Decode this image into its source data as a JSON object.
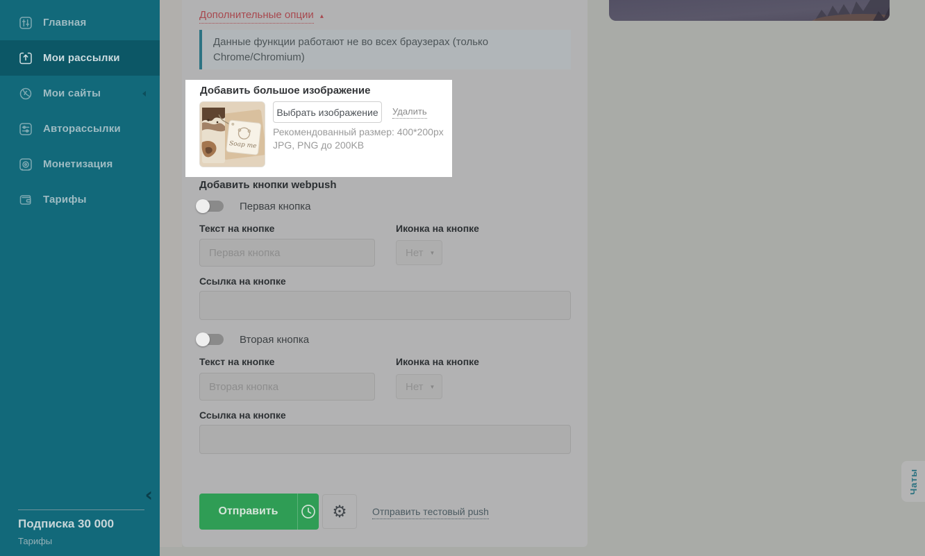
{
  "colors": {
    "sidebar_bg": "#12697a",
    "sidebar_active_bg": "#0c5766",
    "accent_teal": "#2c7383",
    "link_red": "#a8494f",
    "button_green": "#2f9d55",
    "spotlight_bg": "#ffffff"
  },
  "sidebar": {
    "items": [
      {
        "icon": "sliders-icon",
        "label": "Главная",
        "active": false
      },
      {
        "icon": "upload-icon",
        "label": "Мои рассылки",
        "active": true
      },
      {
        "icon": "globe-icon",
        "label": "Мои сайты",
        "active": false,
        "has_submenu": true
      },
      {
        "icon": "automation-icon",
        "label": "Авторассылки",
        "active": false
      },
      {
        "icon": "safe-icon",
        "label": "Монетизация",
        "active": false
      },
      {
        "icon": "wallet-icon",
        "label": "Тарифы",
        "active": false
      }
    ],
    "collapse_icon": "‹",
    "subscription_title": "Подписка 30 000",
    "subscription_link": "Тарифы"
  },
  "main": {
    "options_toggle": {
      "label": "Дополнительные опции",
      "arrow": "▴"
    },
    "browser_note": "Данные функции работают не во всех браузерах (только Chrome/Chromium)",
    "big_image": {
      "title": "Добавить большое изображение",
      "choose_button": "Выбрать изображение",
      "delete_link": "Удалить",
      "hint_line1": "Рекомендованный размер: 400*200px",
      "hint_line2": "JPG, PNG до 200KB",
      "thumb_tag_text": "Soap me"
    },
    "webpush_buttons": {
      "title": "Добавить кнопки webpush",
      "groups": [
        {
          "toggle_label": "Первая кнопка",
          "text_label": "Текст на кнопке",
          "icon_label": "Иконка на кнопке",
          "text_placeholder": "Первая кнопка",
          "icon_value": "Нет",
          "link_label": "Ссылка на кнопке",
          "link_value": ""
        },
        {
          "toggle_label": "Вторая кнопка",
          "text_label": "Текст на кнопке",
          "icon_label": "Иконка на кнопке",
          "text_placeholder": "Вторая кнопка",
          "icon_value": "Нет",
          "link_label": "Ссылка на кнопке",
          "link_value": ""
        }
      ]
    },
    "actions": {
      "send_button": "Отправить",
      "test_link": "Отправить тестовый push",
      "gear_icon": "⚙"
    }
  },
  "chat_tab": {
    "label": "Чаты"
  }
}
